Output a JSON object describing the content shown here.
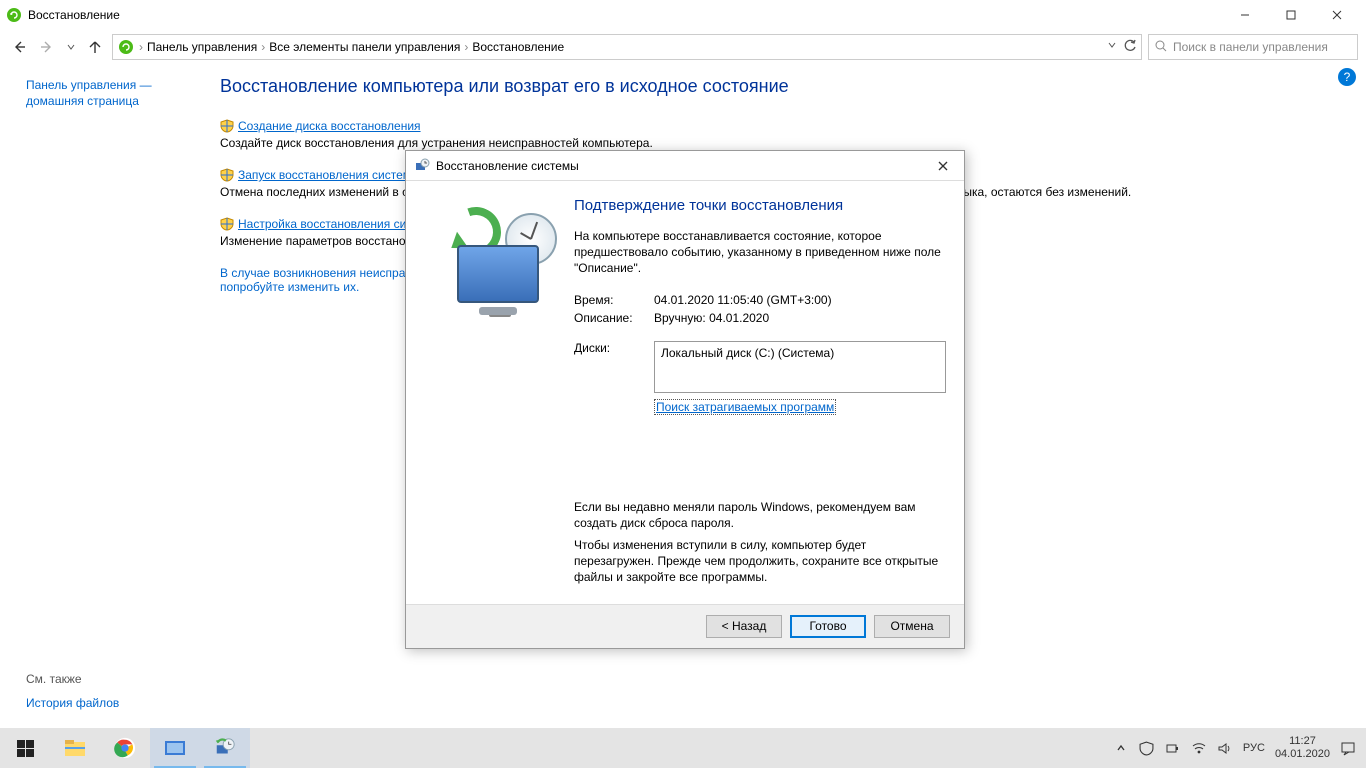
{
  "window": {
    "title": "Восстановление"
  },
  "breadcrumb": {
    "a": "Панель управления",
    "b": "Все элементы панели управления",
    "c": "Восстановление"
  },
  "search": {
    "placeholder": "Поиск в панели управления"
  },
  "sidebar": {
    "home1": "Панель управления —",
    "home2": "домашняя страница",
    "see_also": "См. также",
    "history": "История файлов"
  },
  "main": {
    "heading": "Восстановление компьютера или возврат его в исходное состояние",
    "opt1_link": "Создание диска восстановления",
    "opt1_desc": "Создайте диск восстановления для устранения неисправностей компьютера.",
    "opt2_link": "Запуск восстановления системы",
    "opt2_desc": "Отмена последних изменений в системе, которые могли вызвать проблемы. Ваши файлы, например документы, изображения и музыка, остаются без изменений.",
    "opt3_link": "Настройка восстановления системы",
    "opt3_desc": "Изменение параметров восстановления, использование пространства на диске, а также создание и удаление точек восстановления.",
    "foot": "В случае возникновения неисправностей на ПК откройте Параметры и попробуйте изменить их."
  },
  "dialog": {
    "title": "Восстановление системы",
    "header": "Подтверждение точки восстановления",
    "intro": "На компьютере восстанавливается состояние, которое предшествовало событию, указанному в приведенном ниже поле \"Описание\".",
    "time_lbl": "Время:",
    "time_val": "04.01.2020 11:05:40 (GMT+3:00)",
    "desc_lbl": "Описание:",
    "desc_val": "Вручную: 04.01.2020",
    "disks_lbl": "Диски:",
    "disk_val": "Локальный диск (C:) (Система)",
    "scan": "Поиск затрагиваемых программ",
    "warn1": "Если вы недавно меняли пароль Windows, рекомендуем вам создать диск сброса пароля.",
    "warn2": "Чтобы изменения вступили в силу, компьютер будет перезагружен. Прежде чем продолжить, сохраните все открытые файлы и закройте все программы.",
    "back": "< Назад",
    "finish": "Готово",
    "cancel": "Отмена"
  },
  "tray": {
    "lang": "РУС",
    "time": "11:27",
    "date": "04.01.2020"
  }
}
